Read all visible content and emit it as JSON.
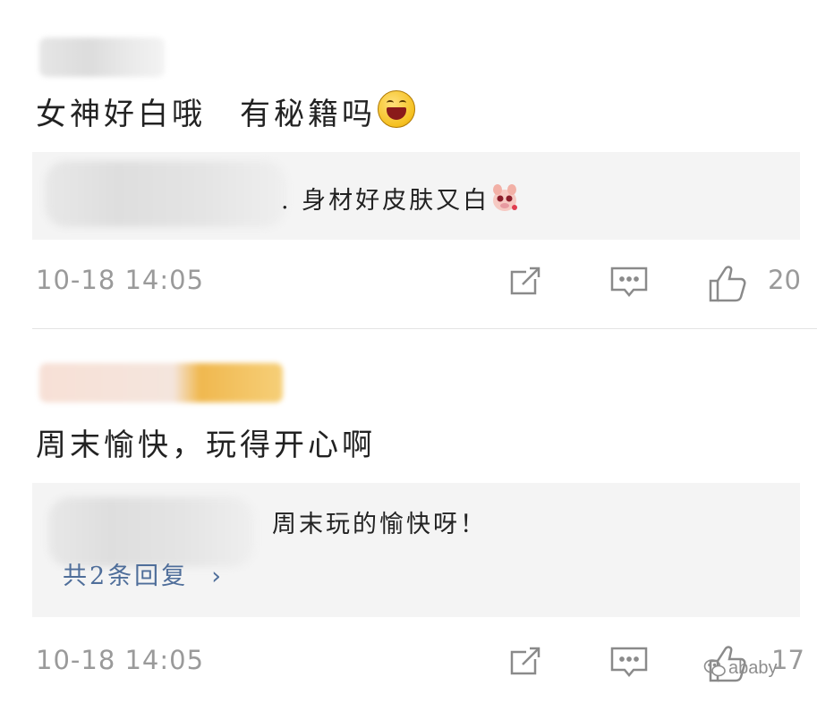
{
  "comments": [
    {
      "text": "女神好白哦　有秘籍吗",
      "emoji": "laughing-emoji",
      "reply": {
        "text": ". 身材好皮肤又白",
        "emoji": "shy-pig-emoji"
      },
      "timestamp": "10-18 14:05",
      "like_count": "20"
    },
    {
      "text": "周末愉快，玩得开心啊",
      "reply": {
        "text": "周末玩的愉快呀！",
        "more_label": "共2条回复",
        "more_icon": "chevron-right"
      },
      "timestamp": "10-18 14:05",
      "like_count": "17"
    }
  ],
  "icons": {
    "share": "share-icon",
    "comment": "comment-icon",
    "like": "thumbs-up-icon"
  },
  "watermark": {
    "text": "ababy",
    "icon": "wechat-icon"
  },
  "colors": {
    "link": "#4f6e9a",
    "meta": "#9a9a9a",
    "reply_bg": "#f4f4f4"
  }
}
